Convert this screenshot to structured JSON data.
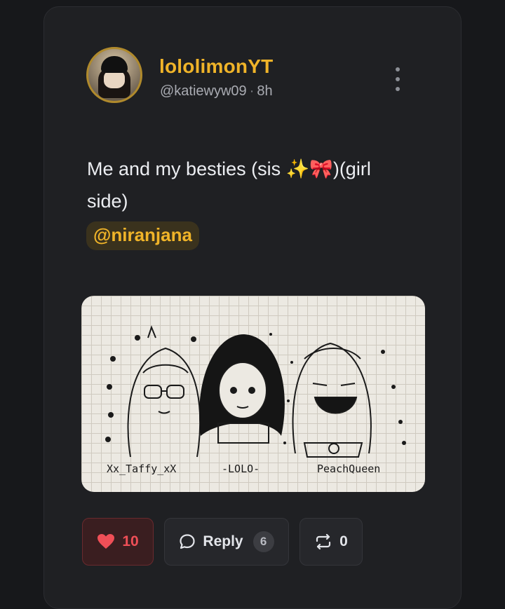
{
  "post": {
    "author_name": "lololimonYT",
    "author_handle": "@katiewyw09",
    "separator": "·",
    "time_ago": "8h",
    "text": "Me and my besties (sis ✨🎀)(girl side)",
    "mention": "@niranjana",
    "image": {
      "captions": [
        "Xx_Taffy_xX",
        "-LOLO-",
        "PeachQueen"
      ]
    }
  },
  "actions": {
    "like_count": "10",
    "reply_label": "Reply",
    "reply_count": "6",
    "repost_count": "0"
  },
  "icons": {
    "like": "heart-icon",
    "reply": "speech-bubble-icon",
    "repost": "repost-icon",
    "more": "more-vertical-icon"
  },
  "colors": {
    "accent": "#f0b429",
    "like": "#ef4f57",
    "background": "#17181b",
    "card": "#1f2023"
  }
}
